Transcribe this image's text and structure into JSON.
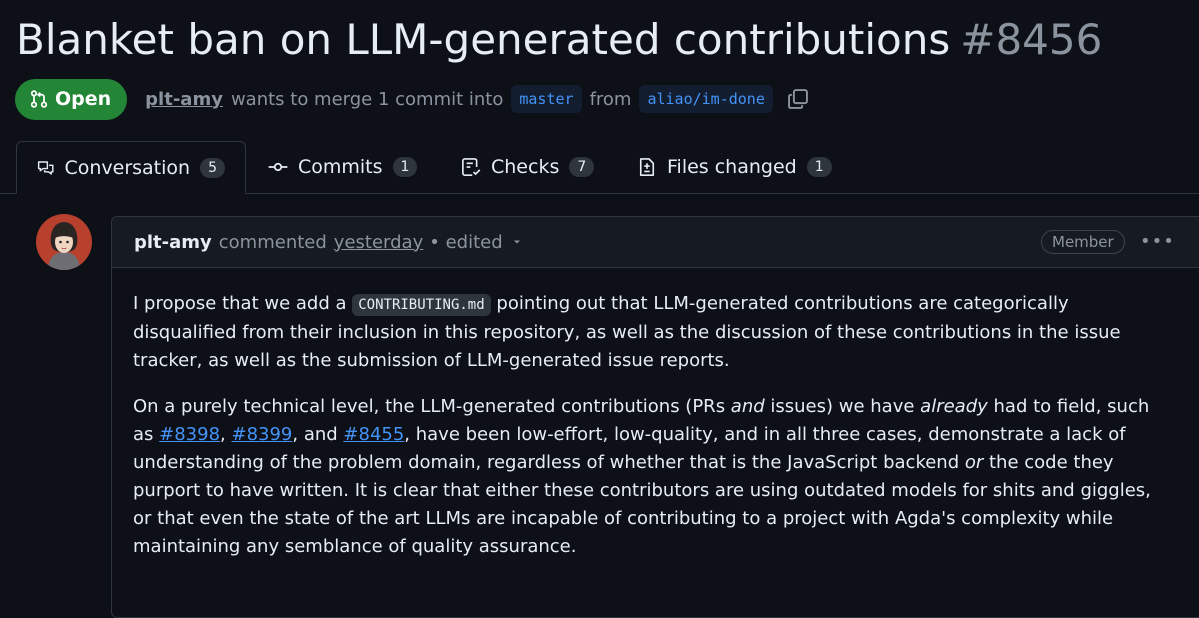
{
  "pr": {
    "title": "Blanket ban on LLM-generated contributions",
    "number": "#8456",
    "state": "Open",
    "author": "plt-amy",
    "merge_text": "wants to merge 1 commit into",
    "base_branch": "master",
    "from_text": "from",
    "head_branch": "aliao/im-done"
  },
  "tabs": [
    {
      "label": "Conversation",
      "count": "5",
      "icon": "comment-discussion-icon"
    },
    {
      "label": "Commits",
      "count": "1",
      "icon": "git-commit-icon"
    },
    {
      "label": "Checks",
      "count": "7",
      "icon": "checklist-icon"
    },
    {
      "label": "Files changed",
      "count": "1",
      "icon": "file-diff-icon"
    }
  ],
  "comment": {
    "author": "plt-amy",
    "action": "commented",
    "time": "yesterday",
    "edited": "• edited",
    "role": "Member",
    "p1": {
      "a": "I propose that we add a ",
      "code": "CONTRIBUTING.md",
      "b": " pointing out that LLM-generated contributions are categorically disqualified from their inclusion in this repository, as well as the discussion of these contributions in the issue tracker, as well as the submission of LLM-generated issue reports."
    },
    "p2": {
      "a": "On a purely technical level, the LLM-generated contributions (PRs ",
      "em1": "and",
      "b": " issues) we have ",
      "em2": "already",
      "c": " had to field, such as ",
      "link1": "#8398",
      "sep1": ", ",
      "link2": "#8399",
      "sep2": ", and ",
      "link3": "#8455",
      "d": ", have been low-effort, low-quality, and in all three cases, demonstrate a lack of understanding of the problem domain, regardless of whether that is the JavaScript backend ",
      "em3": "or",
      "e": " the code they purport to have written. It is clear that either these contributors are using outdated models for shits and giggles, or that even the state of the art LLMs are incapable of contributing to a project with Agda's complexity while maintaining any semblance of quality assurance."
    }
  },
  "colors": {
    "background": "#0d1117",
    "open_green": "#238636",
    "link_blue": "#4493f8",
    "muted": "#8b949e",
    "border": "#30363d"
  }
}
